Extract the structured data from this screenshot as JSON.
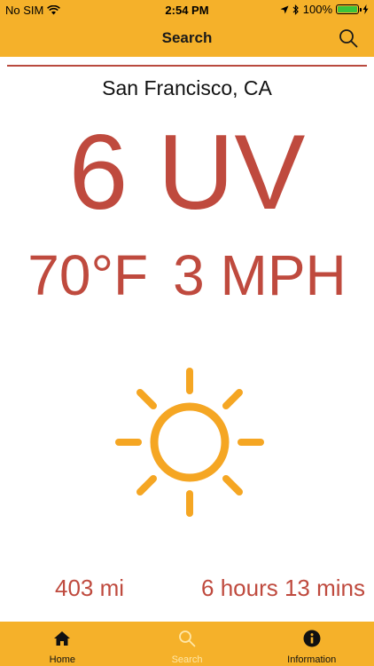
{
  "status_bar": {
    "carrier": "No SIM",
    "time": "2:54 PM",
    "battery": "100%",
    "battery_level": 1.0
  },
  "nav": {
    "title": "Search"
  },
  "location": {
    "city": "San Francisco, CA"
  },
  "uv": {
    "display": "6 UV"
  },
  "weather": {
    "temperature": "70°F",
    "wind": "3 MPH"
  },
  "trip": {
    "distance": "403 mi",
    "duration": "6 hours 13 mins"
  },
  "tabs": [
    {
      "label": "Home",
      "icon": "home-icon"
    },
    {
      "label": "Search",
      "icon": "search-icon"
    },
    {
      "label": "Information",
      "icon": "info-icon"
    }
  ],
  "colors": {
    "header": "#F5B12A",
    "accent_red": "#BF4A3E",
    "sun": "#F5A623",
    "active_tab": "#FFE7A8"
  }
}
